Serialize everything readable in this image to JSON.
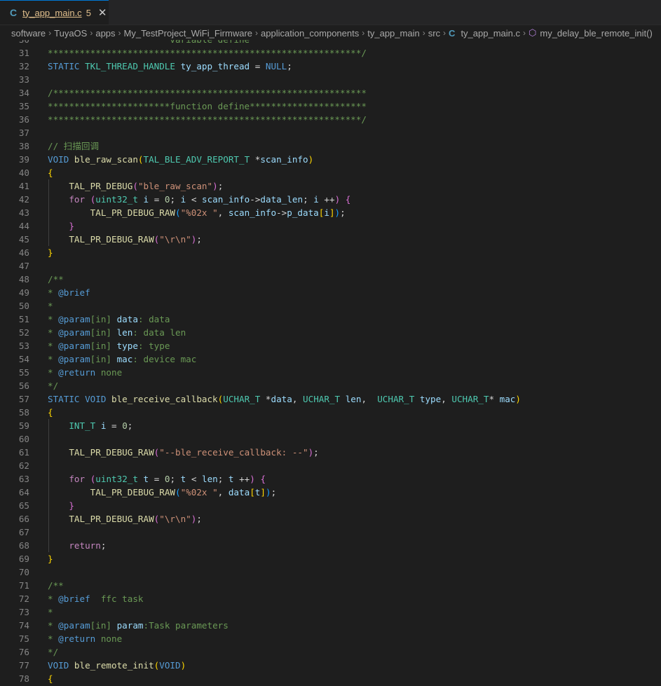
{
  "tab": {
    "icon": "C",
    "title": "ty_app_main.c",
    "badge": "5",
    "close": "✕"
  },
  "breadcrumb": {
    "items": [
      "software",
      "TuyaOS",
      "apps",
      "My_TestProject_WiFi_Firmware",
      "application_components",
      "ty_app_main",
      "src"
    ],
    "file_icon": "C",
    "file": "ty_app_main.c",
    "symbol": "my_delay_ble_remote_init()"
  },
  "colors": {
    "keyword": "#569cd6",
    "type": "#4ec9b0",
    "function": "#dcdcaa",
    "variable": "#9cdcfe",
    "string": "#ce9178",
    "comment": "#6a9955",
    "control": "#c586c0",
    "number": "#b5cea8",
    "bracket1": "#ffd700",
    "bracket2": "#da70d6",
    "bracket3": "#179fff"
  },
  "code_lines": [
    {
      "n": "30",
      "segs": [
        [
          "                       variable define",
          "comment"
        ]
      ]
    },
    {
      "n": "31",
      "segs": [
        [
          "***********************************************************/",
          "comment"
        ]
      ]
    },
    {
      "n": "32",
      "segs": [
        [
          "STATIC ",
          "keyword"
        ],
        [
          "TKL_THREAD_HANDLE ",
          "type"
        ],
        [
          "ty_app_thread",
          "variable"
        ],
        [
          " = ",
          "plain"
        ],
        [
          "NULL",
          "keyword"
        ],
        [
          ";",
          "plain"
        ]
      ]
    },
    {
      "n": "33",
      "segs": []
    },
    {
      "n": "34",
      "segs": [
        [
          "/***********************************************************",
          "comment"
        ]
      ]
    },
    {
      "n": "35",
      "segs": [
        [
          "***********************function define**********************",
          "comment"
        ]
      ]
    },
    {
      "n": "36",
      "segs": [
        [
          "***********************************************************/",
          "comment"
        ]
      ]
    },
    {
      "n": "37",
      "segs": []
    },
    {
      "n": "38",
      "segs": [
        [
          "// 扫描回调",
          "comment"
        ]
      ]
    },
    {
      "n": "39",
      "segs": [
        [
          "VOID ",
          "keyword"
        ],
        [
          "ble_raw_scan",
          "function"
        ],
        [
          "(",
          "bracket1"
        ],
        [
          "TAL_BLE_ADV_REPORT_T ",
          "type"
        ],
        [
          "*",
          "plain"
        ],
        [
          "scan_info",
          "variable"
        ],
        [
          ")",
          "bracket1"
        ]
      ]
    },
    {
      "n": "40",
      "segs": [
        [
          "{",
          "bracket1"
        ]
      ]
    },
    {
      "n": "41",
      "segs": [
        [
          "    ",
          "plain"
        ],
        [
          "TAL_PR_DEBUG",
          "function"
        ],
        [
          "(",
          "bracket2"
        ],
        [
          "\"ble_raw_scan\"",
          "string"
        ],
        [
          ")",
          "bracket2"
        ],
        [
          ";",
          "plain"
        ]
      ]
    },
    {
      "n": "42",
      "segs": [
        [
          "    ",
          "plain"
        ],
        [
          "for ",
          "control"
        ],
        [
          "(",
          "bracket2"
        ],
        [
          "uint32_t ",
          "type"
        ],
        [
          "i",
          "variable"
        ],
        [
          " = ",
          "plain"
        ],
        [
          "0",
          "number"
        ],
        [
          "; ",
          "plain"
        ],
        [
          "i",
          "variable"
        ],
        [
          " < ",
          "plain"
        ],
        [
          "scan_info",
          "variable"
        ],
        [
          "->",
          "plain"
        ],
        [
          "data_len",
          "variable"
        ],
        [
          "; ",
          "plain"
        ],
        [
          "i",
          "variable"
        ],
        [
          " ++",
          "plain"
        ],
        [
          ")",
          "bracket2"
        ],
        [
          " ",
          "plain"
        ],
        [
          "{",
          "bracket2"
        ]
      ]
    },
    {
      "n": "43",
      "segs": [
        [
          "        ",
          "plain"
        ],
        [
          "TAL_PR_DEBUG_RAW",
          "function"
        ],
        [
          "(",
          "bracket3"
        ],
        [
          "\"%02x \"",
          "string"
        ],
        [
          ", ",
          "plain"
        ],
        [
          "scan_info",
          "variable"
        ],
        [
          "->",
          "plain"
        ],
        [
          "p_data",
          "variable"
        ],
        [
          "[",
          "bracket1"
        ],
        [
          "i",
          "variable"
        ],
        [
          "]",
          "bracket1"
        ],
        [
          ")",
          "bracket3"
        ],
        [
          ";",
          "plain"
        ]
      ]
    },
    {
      "n": "44",
      "segs": [
        [
          "    ",
          "plain"
        ],
        [
          "}",
          "bracket2"
        ]
      ]
    },
    {
      "n": "45",
      "segs": [
        [
          "    ",
          "plain"
        ],
        [
          "TAL_PR_DEBUG_RAW",
          "function"
        ],
        [
          "(",
          "bracket2"
        ],
        [
          "\"\\r\\n\"",
          "string"
        ],
        [
          ")",
          "bracket2"
        ],
        [
          ";",
          "plain"
        ]
      ]
    },
    {
      "n": "46",
      "segs": [
        [
          "}",
          "bracket1"
        ]
      ]
    },
    {
      "n": "47",
      "segs": []
    },
    {
      "n": "48",
      "segs": [
        [
          "/**",
          "comment"
        ]
      ]
    },
    {
      "n": "49",
      "segs": [
        [
          "* ",
          "comment"
        ],
        [
          "@brief",
          "keyword"
        ]
      ]
    },
    {
      "n": "50",
      "segs": [
        [
          "*",
          "comment"
        ]
      ]
    },
    {
      "n": "51",
      "segs": [
        [
          "* ",
          "comment"
        ],
        [
          "@param",
          "keyword"
        ],
        [
          "[in] ",
          "comment"
        ],
        [
          "data",
          "variable"
        ],
        [
          ": data",
          "comment"
        ]
      ]
    },
    {
      "n": "52",
      "segs": [
        [
          "* ",
          "comment"
        ],
        [
          "@param",
          "keyword"
        ],
        [
          "[in] ",
          "comment"
        ],
        [
          "len",
          "variable"
        ],
        [
          ": data len",
          "comment"
        ]
      ]
    },
    {
      "n": "53",
      "segs": [
        [
          "* ",
          "comment"
        ],
        [
          "@param",
          "keyword"
        ],
        [
          "[in] ",
          "comment"
        ],
        [
          "type",
          "variable"
        ],
        [
          ": type",
          "comment"
        ]
      ]
    },
    {
      "n": "54",
      "segs": [
        [
          "* ",
          "comment"
        ],
        [
          "@param",
          "keyword"
        ],
        [
          "[in] ",
          "comment"
        ],
        [
          "mac",
          "variable"
        ],
        [
          ": device mac",
          "comment"
        ]
      ]
    },
    {
      "n": "55",
      "segs": [
        [
          "* ",
          "comment"
        ],
        [
          "@return",
          "keyword"
        ],
        [
          " none",
          "comment"
        ]
      ]
    },
    {
      "n": "56",
      "segs": [
        [
          "*/",
          "comment"
        ]
      ]
    },
    {
      "n": "57",
      "segs": [
        [
          "STATIC ",
          "keyword"
        ],
        [
          "VOID ",
          "keyword"
        ],
        [
          "ble_receive_callback",
          "function"
        ],
        [
          "(",
          "bracket1"
        ],
        [
          "UCHAR_T ",
          "type"
        ],
        [
          "*",
          "plain"
        ],
        [
          "data",
          "variable"
        ],
        [
          ", ",
          "plain"
        ],
        [
          "UCHAR_T ",
          "type"
        ],
        [
          "len",
          "variable"
        ],
        [
          ",  ",
          "plain"
        ],
        [
          "UCHAR_T ",
          "type"
        ],
        [
          "type",
          "variable"
        ],
        [
          ", ",
          "plain"
        ],
        [
          "UCHAR_T",
          "type"
        ],
        [
          "* ",
          "plain"
        ],
        [
          "mac",
          "variable"
        ],
        [
          ")",
          "bracket1"
        ]
      ]
    },
    {
      "n": "58",
      "segs": [
        [
          "{",
          "bracket1"
        ]
      ]
    },
    {
      "n": "59",
      "segs": [
        [
          "    ",
          "plain"
        ],
        [
          "INT_T ",
          "type"
        ],
        [
          "i",
          "variable"
        ],
        [
          " = ",
          "plain"
        ],
        [
          "0",
          "number"
        ],
        [
          ";",
          "plain"
        ]
      ]
    },
    {
      "n": "60",
      "segs": []
    },
    {
      "n": "61",
      "segs": [
        [
          "    ",
          "plain"
        ],
        [
          "TAL_PR_DEBUG_RAW",
          "function"
        ],
        [
          "(",
          "bracket2"
        ],
        [
          "\"--ble_receive_callback: --\"",
          "string"
        ],
        [
          ")",
          "bracket2"
        ],
        [
          ";",
          "plain"
        ]
      ]
    },
    {
      "n": "62",
      "segs": []
    },
    {
      "n": "63",
      "segs": [
        [
          "    ",
          "plain"
        ],
        [
          "for ",
          "control"
        ],
        [
          "(",
          "bracket2"
        ],
        [
          "uint32_t ",
          "type"
        ],
        [
          "t",
          "variable"
        ],
        [
          " = ",
          "plain"
        ],
        [
          "0",
          "number"
        ],
        [
          "; ",
          "plain"
        ],
        [
          "t",
          "variable"
        ],
        [
          " < ",
          "plain"
        ],
        [
          "len",
          "variable"
        ],
        [
          "; ",
          "plain"
        ],
        [
          "t",
          "variable"
        ],
        [
          " ++",
          "plain"
        ],
        [
          ")",
          "bracket2"
        ],
        [
          " ",
          "plain"
        ],
        [
          "{",
          "bracket2"
        ]
      ]
    },
    {
      "n": "64",
      "segs": [
        [
          "        ",
          "plain"
        ],
        [
          "TAL_PR_DEBUG_RAW",
          "function"
        ],
        [
          "(",
          "bracket3"
        ],
        [
          "\"%02x \"",
          "string"
        ],
        [
          ", ",
          "plain"
        ],
        [
          "data",
          "variable"
        ],
        [
          "[",
          "bracket1"
        ],
        [
          "t",
          "variable"
        ],
        [
          "]",
          "bracket1"
        ],
        [
          ")",
          "bracket3"
        ],
        [
          ";",
          "plain"
        ]
      ]
    },
    {
      "n": "65",
      "segs": [
        [
          "    ",
          "plain"
        ],
        [
          "}",
          "bracket2"
        ]
      ]
    },
    {
      "n": "66",
      "segs": [
        [
          "    ",
          "plain"
        ],
        [
          "TAL_PR_DEBUG_RAW",
          "function"
        ],
        [
          "(",
          "bracket2"
        ],
        [
          "\"\\r\\n\"",
          "string"
        ],
        [
          ")",
          "bracket2"
        ],
        [
          ";",
          "plain"
        ]
      ]
    },
    {
      "n": "67",
      "segs": []
    },
    {
      "n": "68",
      "segs": [
        [
          "    ",
          "plain"
        ],
        [
          "return",
          "control"
        ],
        [
          ";",
          "plain"
        ]
      ]
    },
    {
      "n": "69",
      "segs": [
        [
          "}",
          "bracket1"
        ]
      ]
    },
    {
      "n": "70",
      "segs": []
    },
    {
      "n": "71",
      "segs": [
        [
          "/**",
          "comment"
        ]
      ]
    },
    {
      "n": "72",
      "segs": [
        [
          "* ",
          "comment"
        ],
        [
          "@brief",
          "keyword"
        ],
        [
          "  ffc task",
          "comment"
        ]
      ]
    },
    {
      "n": "73",
      "segs": [
        [
          "*",
          "comment"
        ]
      ]
    },
    {
      "n": "74",
      "segs": [
        [
          "* ",
          "comment"
        ],
        [
          "@param",
          "keyword"
        ],
        [
          "[in] ",
          "comment"
        ],
        [
          "param",
          "variable"
        ],
        [
          ":Task parameters",
          "comment"
        ]
      ]
    },
    {
      "n": "75",
      "segs": [
        [
          "* ",
          "comment"
        ],
        [
          "@return",
          "keyword"
        ],
        [
          " none",
          "comment"
        ]
      ]
    },
    {
      "n": "76",
      "segs": [
        [
          "*/",
          "comment"
        ]
      ]
    },
    {
      "n": "77",
      "segs": [
        [
          "VOID ",
          "keyword"
        ],
        [
          "ble_remote_init",
          "function"
        ],
        [
          "(",
          "bracket1"
        ],
        [
          "VOID",
          "keyword"
        ],
        [
          ")",
          "bracket1"
        ]
      ]
    },
    {
      "n": "78",
      "segs": [
        [
          "{",
          "bracket1"
        ]
      ]
    }
  ]
}
